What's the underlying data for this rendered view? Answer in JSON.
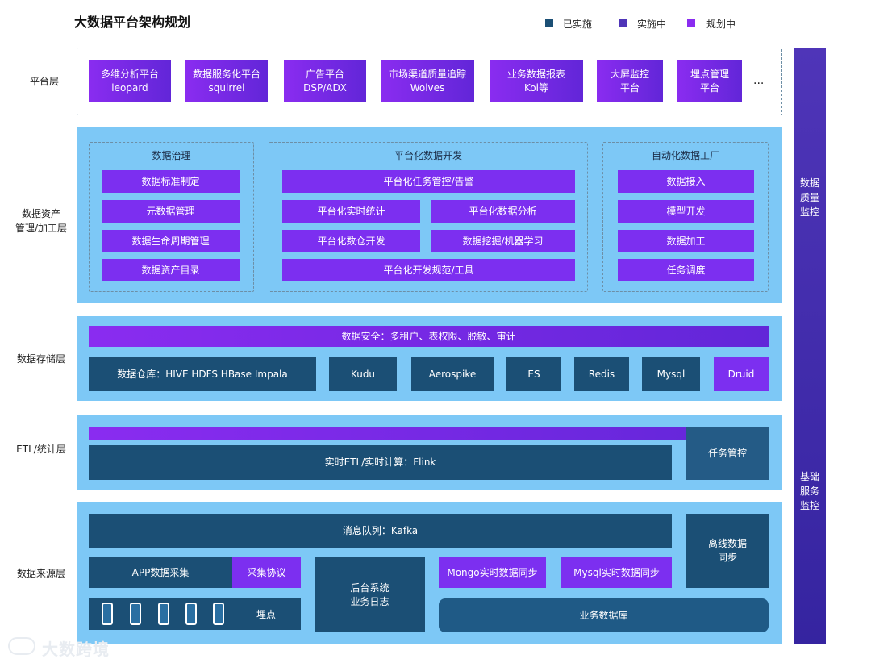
{
  "title": "大数据平台架构规划",
  "legend": [
    {
      "label": "已实施",
      "color": "#1b4f75"
    },
    {
      "label": "实施中",
      "color": "#4f35b8"
    },
    {
      "label": "规划中",
      "color": "#8a2cf0"
    }
  ],
  "layers": {
    "platform": "平台层",
    "asset": "数据资产\n管理/加工层",
    "storage": "数据存储层",
    "etl": "ETL/统计层",
    "source": "数据来源层"
  },
  "platform_items": [
    "多维分析平台\nleopard",
    "数据服务化平台\nsquirrel",
    "广告平台\nDSP/ADX",
    "市场渠道质量追踪\nWolves",
    "业务数据报表\nKoi等",
    "大屏监控\n平台",
    "埋点管理\n平台"
  ],
  "platform_more": "...",
  "governance": {
    "title": "数据治理",
    "items": [
      "数据标准制定",
      "元数据管理",
      "数据生命周期管理",
      "数据资产目录"
    ]
  },
  "platform_dev": {
    "title": "平台化数据开发",
    "task_control": "平台化任务管控/告警",
    "realtime_stat": "平台化实时统计",
    "data_analysis": "平台化数据分析",
    "warehouse_dev": "平台化数仓开发",
    "mining_ml": "数据挖掘/机器学习",
    "dev_standard": "平台化开发规范/工具"
  },
  "auto_factory": {
    "title": "自动化数据工厂",
    "items": [
      "数据接入",
      "模型开发",
      "数据加工",
      "任务调度"
    ]
  },
  "storage": {
    "security": "数据安全：多租户、表权限、脱敏、审计",
    "warehouse": "数据仓库：HIVE HDFS HBase Impala",
    "kudu": "Kudu",
    "aerospike": "Aerospike",
    "es": "ES",
    "redis": "Redis",
    "mysql": "Mysql",
    "druid": "Druid"
  },
  "etl": {
    "flink": "实时ETL/实时计算：Flink",
    "task_control": "任务管控"
  },
  "source": {
    "kafka": "消息队列：Kafka",
    "offline_sync": "离线数据\n同步",
    "app_collect": "APP数据采集",
    "protocol": "采集协议",
    "backend_log": "后台系统\n业务日志",
    "mongo_sync": "Mongo实时数据同步",
    "mysql_sync": "Mysql实时数据同步",
    "tracking": "埋点",
    "business_db": "业务数据库"
  },
  "side": {
    "quality": "数据\n质量\n监控",
    "service": "基础\n服务\n监控"
  },
  "watermark": "大数跨境"
}
